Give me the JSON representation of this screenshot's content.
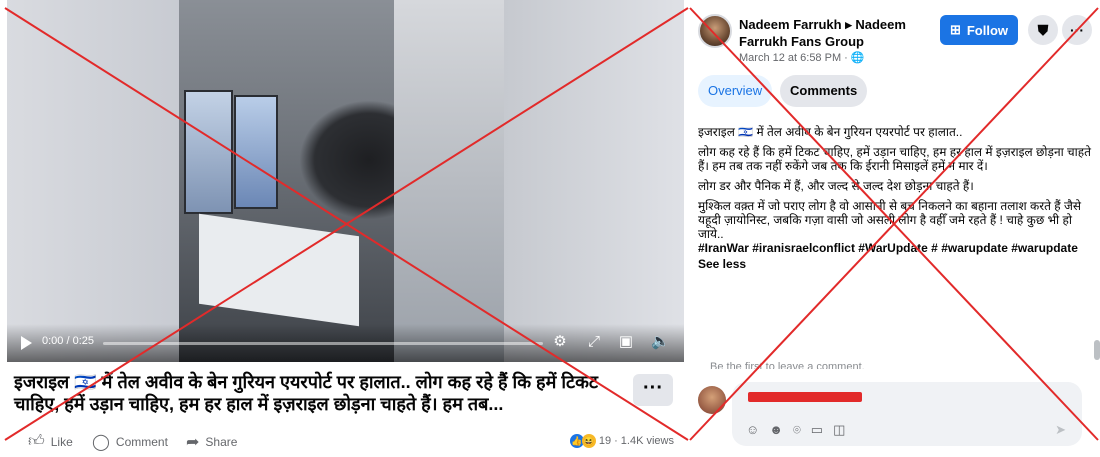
{
  "video": {
    "time": "0:00 / 0:25",
    "progress_fraction": 0
  },
  "post_title": "इजराइल 🇮🇱 में तेल अवीव के बेन गुरियन एयरपोर्ट पर हालात.. लोग कह रहे हैं कि हमें टिकट चाहिए, हमें उड़ान चाहिए, हम हर हाल में इज़राइल छोड़ना चाहते हैं। हम तब...",
  "actions": {
    "like": "Like",
    "comment": "Comment",
    "share": "Share",
    "reaction_count": "19",
    "views": "· 1.4K views"
  },
  "post": {
    "author": "Nadeem Farrukh ▸ Nadeem Farrukh Fans Group",
    "date": "March 12 at 6:58 PM · 🌐",
    "follow": "Follow"
  },
  "tabs": [
    "Overview",
    "Comments"
  ],
  "description": {
    "p1": "इजराइल 🇮🇱 में तेल अवीव के बेन गुरियन एयरपोर्ट पर हालात..",
    "p2": "लोग कह रहे हैं कि हमें टिकट चाहिए, हमें उड़ान चाहिए, हम हर हाल में इज़राइल छोड़ना चाहते हैं। हम तब तक नहीं रुकेंगे जब तक कि ईरानी मिसाइलें हमें न मार दें।",
    "p3": "लोग डर और पैनिक में हैं, और जल्द से जल्द देश छोड़ना चाहते हैं।",
    "p4": "मुश्किल वक़्त में जो पराए लोग है वो आसानी से बच निकलने का बहाना तलाश करते हैं जैसे यहूदी ज़ायोनिस्ट, जबकि गज़ा वासी जो असली लोग है वहीँ जमे रहते हैं ! चाहे कुछ भी हो जाये..",
    "hashtags": "#IranWar #iranisraelconflict #WarUpdate # #warupdate #warupdate",
    "see_less": "See less"
  },
  "comments": {
    "first_prompt": "Be the first to leave a comment."
  },
  "colors": {
    "accent": "#1b74e4",
    "strike": "#e22a2a"
  }
}
